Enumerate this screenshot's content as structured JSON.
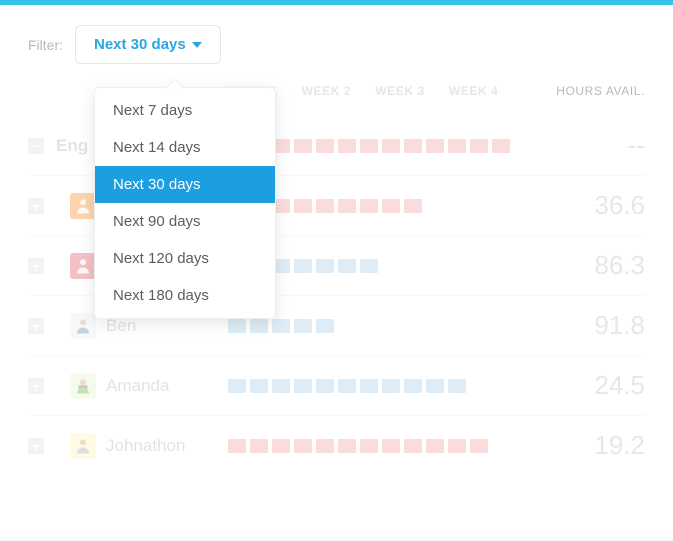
{
  "filter": {
    "label": "Filter:",
    "selected": "Next 30 days",
    "options": [
      "Next 7 days",
      "Next 14 days",
      "Next 30 days",
      "Next 90 days",
      "Next 120 days",
      "Next 180 days"
    ]
  },
  "headers": {
    "weeks": [
      "WEEK 1",
      "WEEK 2",
      "WEEK 3",
      "WEEK 4"
    ],
    "hours": "HOURS AVAIL."
  },
  "group": {
    "name": "Eng",
    "hours": "--"
  },
  "rows": [
    {
      "name": "",
      "hours": "36.6",
      "avatar_bg": "#f7a24a",
      "bar": [
        "red",
        "red",
        "red",
        "red",
        "red",
        "red",
        "red",
        "red",
        "red",
        "empty",
        "empty",
        "empty",
        "empty"
      ]
    },
    {
      "name": "",
      "hours": "86.3",
      "avatar_bg": "#e9767d",
      "bar": [
        "blue",
        "blue",
        "blue",
        "blue",
        "blue",
        "blue",
        "blue",
        "empty",
        "empty",
        "empty",
        "empty",
        "empty",
        "empty"
      ]
    },
    {
      "name": "Ben",
      "hours": "91.8",
      "avatar_bg": "#eef0f2",
      "bar": [
        "blue",
        "blue",
        "blue",
        "blue",
        "blue",
        "empty",
        "empty",
        "empty",
        "empty",
        "empty",
        "empty",
        "empty",
        "empty"
      ]
    },
    {
      "name": "Amanda",
      "hours": "24.5",
      "avatar_bg": "#e9f7d2",
      "bar": [
        "blue",
        "blue",
        "blue",
        "blue",
        "blue",
        "blue",
        "blue",
        "blue",
        "blue",
        "blue",
        "blue",
        "empty",
        "empty"
      ]
    },
    {
      "name": "Johnathon",
      "hours": "19.2",
      "avatar_bg": "#fff6c2",
      "bar": [
        "red",
        "red",
        "red",
        "red",
        "red",
        "red",
        "red",
        "red",
        "red",
        "red",
        "red",
        "red",
        "empty"
      ]
    }
  ]
}
